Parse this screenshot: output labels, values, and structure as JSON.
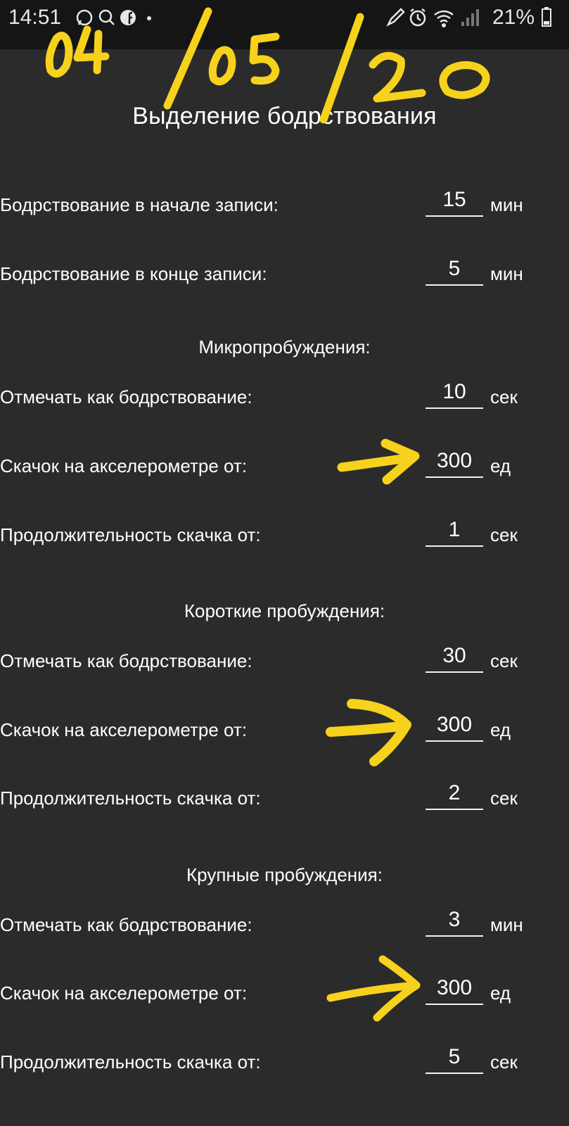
{
  "status_bar": {
    "time": "14:51",
    "battery_percent": "21%",
    "icons_left": [
      "whatsapp-icon",
      "search-icon",
      "facebook-icon",
      "dot-icon"
    ],
    "icons_right": [
      "edit-icon",
      "alarm-icon",
      "wifi-icon",
      "signal-icon",
      "battery-icon"
    ]
  },
  "title": "Выделение бодрствования",
  "handwritten_date": "04/05/20",
  "rows": [
    {
      "label": "Бодрствование в начале записи:",
      "value": "15",
      "unit": "мин"
    },
    {
      "label": "Бодрствование в конце записи:",
      "value": "5",
      "unit": "мин"
    }
  ],
  "sections": [
    {
      "header": "Микропробуждения:",
      "rows": [
        {
          "label": "Отмечать как бодрствование:",
          "value": "10",
          "unit": "сек"
        },
        {
          "label": "Скачок на акселерометре от:",
          "value": "300",
          "unit": "ед"
        },
        {
          "label": "Продолжительность скачка от:",
          "value": "1",
          "unit": "сек"
        }
      ]
    },
    {
      "header": "Короткие пробуждения:",
      "rows": [
        {
          "label": "Отмечать как бодрствование:",
          "value": "30",
          "unit": "сек"
        },
        {
          "label": "Скачок на акселерометре от:",
          "value": "300",
          "unit": "ед"
        },
        {
          "label": "Продолжительность скачка от:",
          "value": "2",
          "unit": "сек"
        }
      ]
    },
    {
      "header": "Крупные пробуждения:",
      "rows": [
        {
          "label": "Отмечать как бодрствование:",
          "value": "3",
          "unit": "мин"
        },
        {
          "label": "Скачок на акселерометре от:",
          "value": "300",
          "unit": "ед"
        },
        {
          "label": "Продолжительность скачка от:",
          "value": "5",
          "unit": "сек"
        }
      ]
    }
  ],
  "colors": {
    "background": "#2b2b2b",
    "status_bar": "#151515",
    "text": "#ffffff",
    "annotation": "#f7d21c"
  }
}
